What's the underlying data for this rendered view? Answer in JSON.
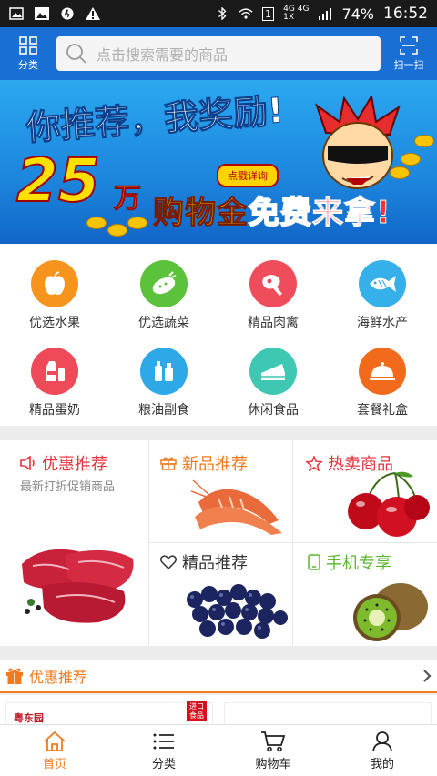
{
  "status_bar": {
    "network": "4G 4G",
    "sim": "1X",
    "battery": "74%",
    "time": "16:52",
    "sim_slot": "1"
  },
  "header": {
    "category_label": "分类",
    "search_placeholder": "点击搜索需要的商品",
    "scan_label": "扫一扫"
  },
  "banner": {
    "headline": "你推荐，我奖励!",
    "amount": "25",
    "amount_unit": "万",
    "tagline_pre": "购物金",
    "tagline_free": "免费",
    "tagline_post": "来拿!",
    "detail_button": "点戳详询"
  },
  "categories": [
    {
      "label": "优选水果",
      "icon": "apple-icon",
      "color": "#f7941d"
    },
    {
      "label": "优选蔬菜",
      "icon": "vegetable-icon",
      "color": "#5cc13b"
    },
    {
      "label": "精品肉禽",
      "icon": "meat-icon",
      "color": "#ef4d5b"
    },
    {
      "label": "海鲜水产",
      "icon": "fish-icon",
      "color": "#36b0e8"
    },
    {
      "label": "精品蛋奶",
      "icon": "milk-icon",
      "color": "#ee4a5a"
    },
    {
      "label": "粮油副食",
      "icon": "oil-icon",
      "color": "#2ea8e6"
    },
    {
      "label": "休闲食品",
      "icon": "cake-icon",
      "color": "#3ec7b2"
    },
    {
      "label": "套餐礼盒",
      "icon": "dish-icon",
      "color": "#f26b1d"
    }
  ],
  "promo": {
    "discount": {
      "title": "优惠推荐",
      "subtitle": "最新打折促销商品",
      "icon": "megaphone-icon",
      "color": "#e8323c"
    },
    "new": {
      "title": "新品推荐",
      "icon": "gift-icon",
      "color": "#f07a1e"
    },
    "hot": {
      "title": "热卖商品",
      "icon": "star-icon",
      "color": "#e8323c"
    },
    "quality": {
      "title": "精品推荐",
      "icon": "heart-icon",
      "color": "#333333"
    },
    "mobile": {
      "title": "手机专享",
      "icon": "phone-icon",
      "color": "#5cb531"
    }
  },
  "section": {
    "title": "优惠推荐",
    "icon": "gift-icon",
    "accent": "#f07a1e"
  },
  "cards": {
    "badge": "进口食品",
    "brand": "粤东园"
  },
  "tabbar": [
    {
      "label": "首页",
      "icon": "home-icon",
      "active": true
    },
    {
      "label": "分类",
      "icon": "list-icon",
      "active": false
    },
    {
      "label": "购物车",
      "icon": "cart-icon",
      "active": false
    },
    {
      "label": "我的",
      "icon": "user-icon",
      "active": false
    }
  ]
}
